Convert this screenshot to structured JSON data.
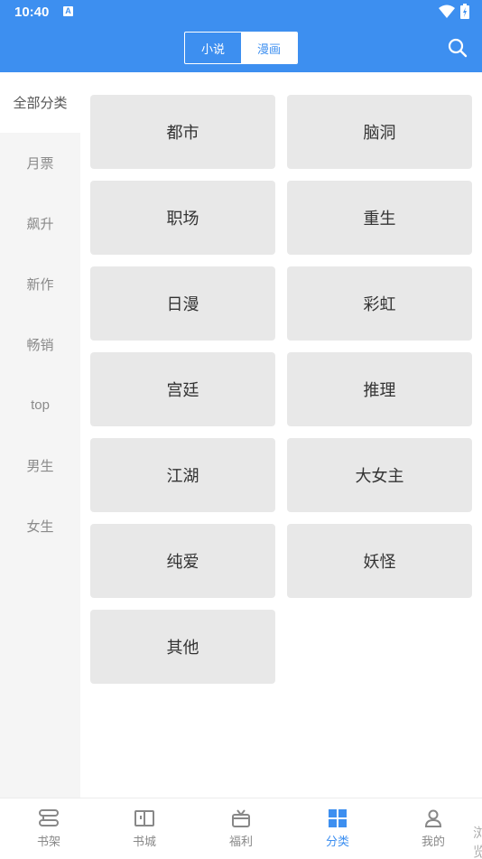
{
  "status_bar": {
    "time": "10:40",
    "a_badge": "A"
  },
  "header": {
    "tabs": [
      {
        "label": "小说",
        "active": false
      },
      {
        "label": "漫画",
        "active": true
      }
    ],
    "search_icon": "search-icon",
    "accent": "#3d8ff0"
  },
  "sidebar": {
    "items": [
      {
        "label": "全部分类",
        "active": true
      },
      {
        "label": "月票"
      },
      {
        "label": "飙升"
      },
      {
        "label": "新作"
      },
      {
        "label": "畅销"
      },
      {
        "label": "top"
      },
      {
        "label": "男生"
      },
      {
        "label": "女生"
      }
    ]
  },
  "categories": [
    "都市",
    "脑洞",
    "职场",
    "重生",
    "日漫",
    "彩虹",
    "宫廷",
    "推理",
    "江湖",
    "大女主",
    "纯爱",
    "妖怪",
    "其他"
  ],
  "bottom_nav": {
    "items": [
      {
        "label": "书架",
        "icon": "bookshelf-icon"
      },
      {
        "label": "书城",
        "icon": "open-book-icon"
      },
      {
        "label": "福利",
        "icon": "gift-icon"
      },
      {
        "label": "分类",
        "icon": "grid-icon",
        "active": true
      },
      {
        "label": "我的",
        "icon": "user-icon"
      }
    ],
    "edge_text": "浏览"
  }
}
